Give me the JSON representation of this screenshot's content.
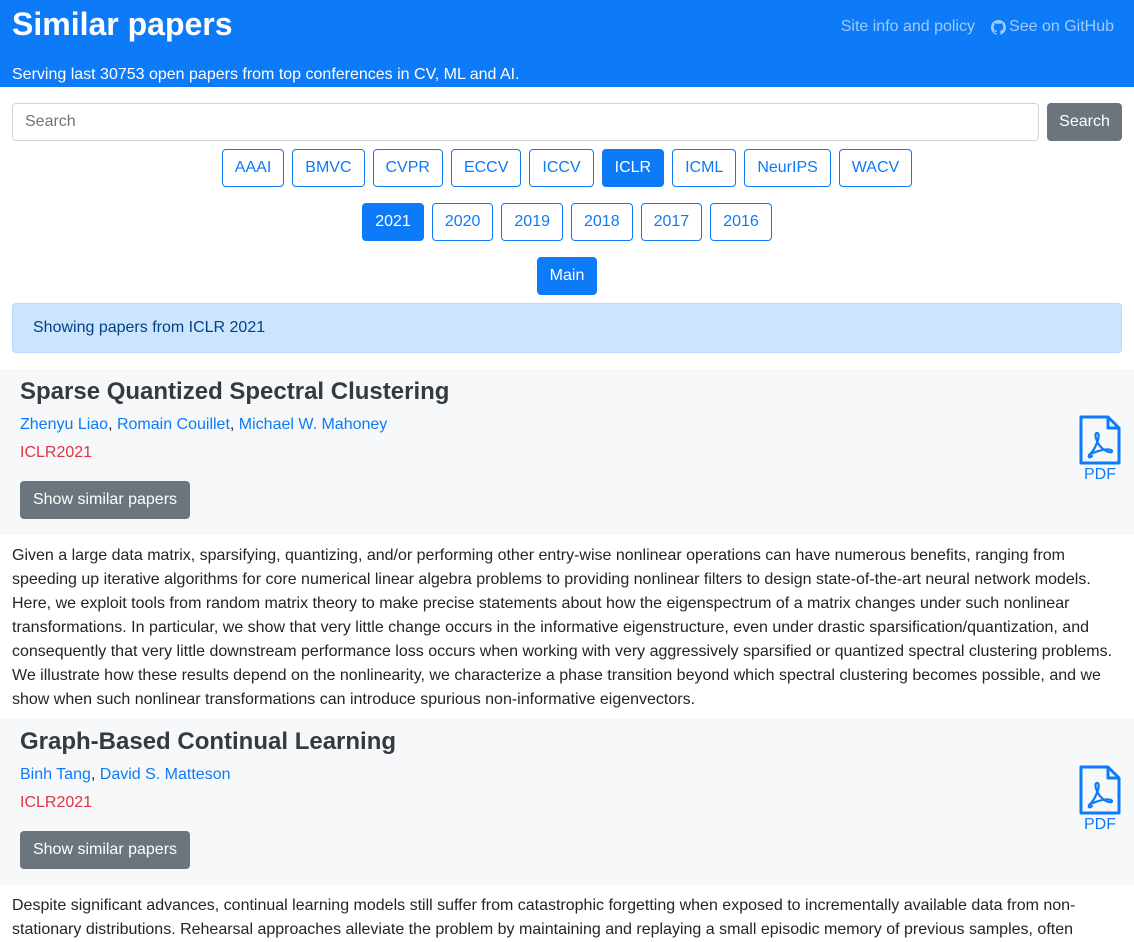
{
  "header": {
    "title": "Similar papers",
    "subtitle": "Serving last 30753 open papers from top conferences in CV, ML and AI.",
    "links": [
      {
        "label": "Site info and policy",
        "icon": ""
      },
      {
        "label": "See on GitHub",
        "icon": "github-icon"
      }
    ]
  },
  "search": {
    "placeholder": "Search",
    "button_label": "Search"
  },
  "conferences": [
    {
      "label": "AAAI",
      "active": false
    },
    {
      "label": "BMVC",
      "active": false
    },
    {
      "label": "CVPR",
      "active": false
    },
    {
      "label": "ECCV",
      "active": false
    },
    {
      "label": "ICCV",
      "active": false
    },
    {
      "label": "ICLR",
      "active": true
    },
    {
      "label": "ICML",
      "active": false
    },
    {
      "label": "NeurIPS",
      "active": false
    },
    {
      "label": "WACV",
      "active": false
    }
  ],
  "years": [
    {
      "label": "2021",
      "active": true
    },
    {
      "label": "2020",
      "active": false
    },
    {
      "label": "2019",
      "active": false
    },
    {
      "label": "2018",
      "active": false
    },
    {
      "label": "2017",
      "active": false
    },
    {
      "label": "2016",
      "active": false
    }
  ],
  "tracks": [
    {
      "label": "Main",
      "active": true
    }
  ],
  "alert": "Showing papers from ICLR 2021",
  "papers": [
    {
      "title": "Sparse Quantized Spectral Clustering",
      "authors": [
        "Zhenyu Liao",
        "Romain Couillet",
        "Michael W. Mahoney"
      ],
      "venue": "ICLR2021",
      "similar_label": "Show similar papers",
      "pdf_label": "PDF",
      "abstract": "Given a large data matrix, sparsifying, quantizing, and/or performing other entry-wise nonlinear operations can have numerous benefits, ranging from speeding up iterative algorithms for core numerical linear algebra problems to providing nonlinear filters to design state-of-the-art neural network models. Here, we exploit tools from random matrix theory to make precise statements about how the eigenspectrum of a matrix changes under such nonlinear transformations. In particular, we show that very little change occurs in the informative eigenstructure, even under drastic sparsification/quantization, and consequently that very little downstream performance loss occurs when working with very aggressively sparsified or quantized spectral clustering problems. We illustrate how these results depend on the nonlinearity, we characterize a phase transition beyond which spectral clustering becomes possible, and we show when such nonlinear transformations can introduce spurious non-informative eigenvectors."
    },
    {
      "title": "Graph-Based Continual Learning",
      "authors": [
        "Binh Tang",
        "David S. Matteson"
      ],
      "venue": "ICLR2021",
      "similar_label": "Show similar papers",
      "pdf_label": "PDF",
      "abstract": "Despite significant advances, continual learning models still suffer from catastrophic forgetting when exposed to incrementally available data from non-stationary distributions. Rehearsal approaches alleviate the problem by maintaining and replaying a small episodic memory of previous samples, often"
    }
  ],
  "colors": {
    "primary": "#0d7bf7",
    "secondary": "#6c757d",
    "venue": "#dc3545",
    "alert_bg": "#cce5ff"
  }
}
